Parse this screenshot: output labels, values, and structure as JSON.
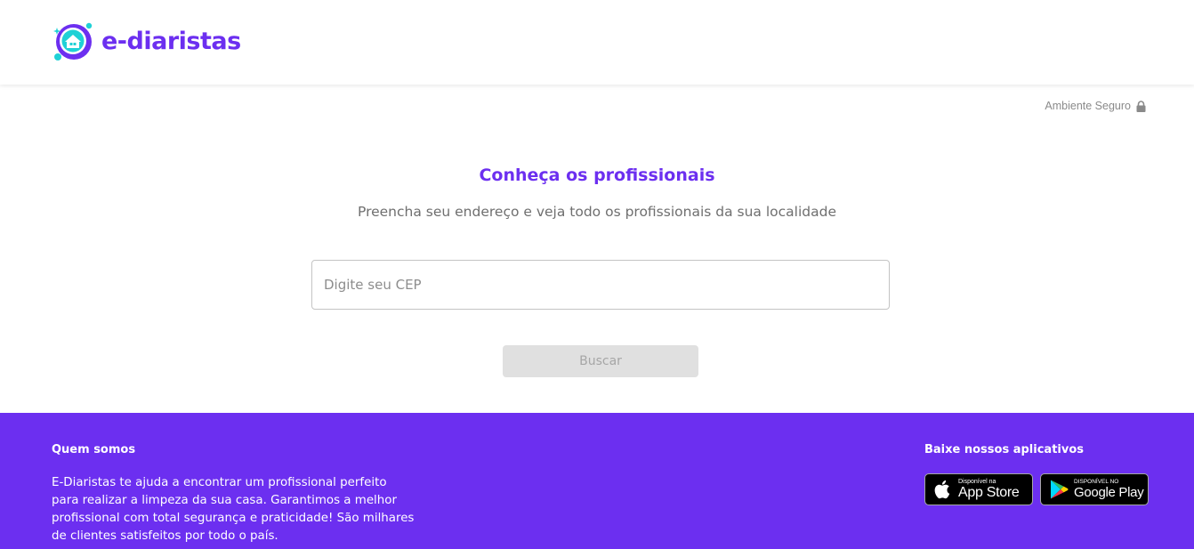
{
  "header": {
    "brand_name": "e-diaristas",
    "logo_icon": "house-bubble-logo-icon"
  },
  "secure_badge": {
    "label": "Ambiente Seguro",
    "icon": "lock-icon"
  },
  "search": {
    "title": "Conheça os profissionais",
    "subtitle": "Preencha seu endereço e veja todo os profissionais da sua localidade",
    "cep_placeholder": "Digite seu CEP",
    "cep_value": "",
    "button_label": "Buscar"
  },
  "footer": {
    "about_title": "Quem somos",
    "about_text": "E-Diaristas te ajuda a encontrar um profissional perfeito para realizar a limpeza da sua casa. Garantimos a melhor profissional com total segurança e praticidade! São milhares de clientes satisfeitos por todo o país.",
    "apps_title": "Baixe nossos aplicativos",
    "app_store": {
      "small": "Disponível na",
      "big": "App Store",
      "icon": "apple-icon"
    },
    "google_play": {
      "small": "DISPONÍVEL NO",
      "big": "Google Play",
      "icon": "google-play-icon"
    }
  },
  "colors": {
    "brand": "#6c2ff0",
    "accent": "#1fd1d6",
    "button_disabled_bg": "#e0e0e0",
    "button_disabled_text": "#a6a6a6"
  }
}
